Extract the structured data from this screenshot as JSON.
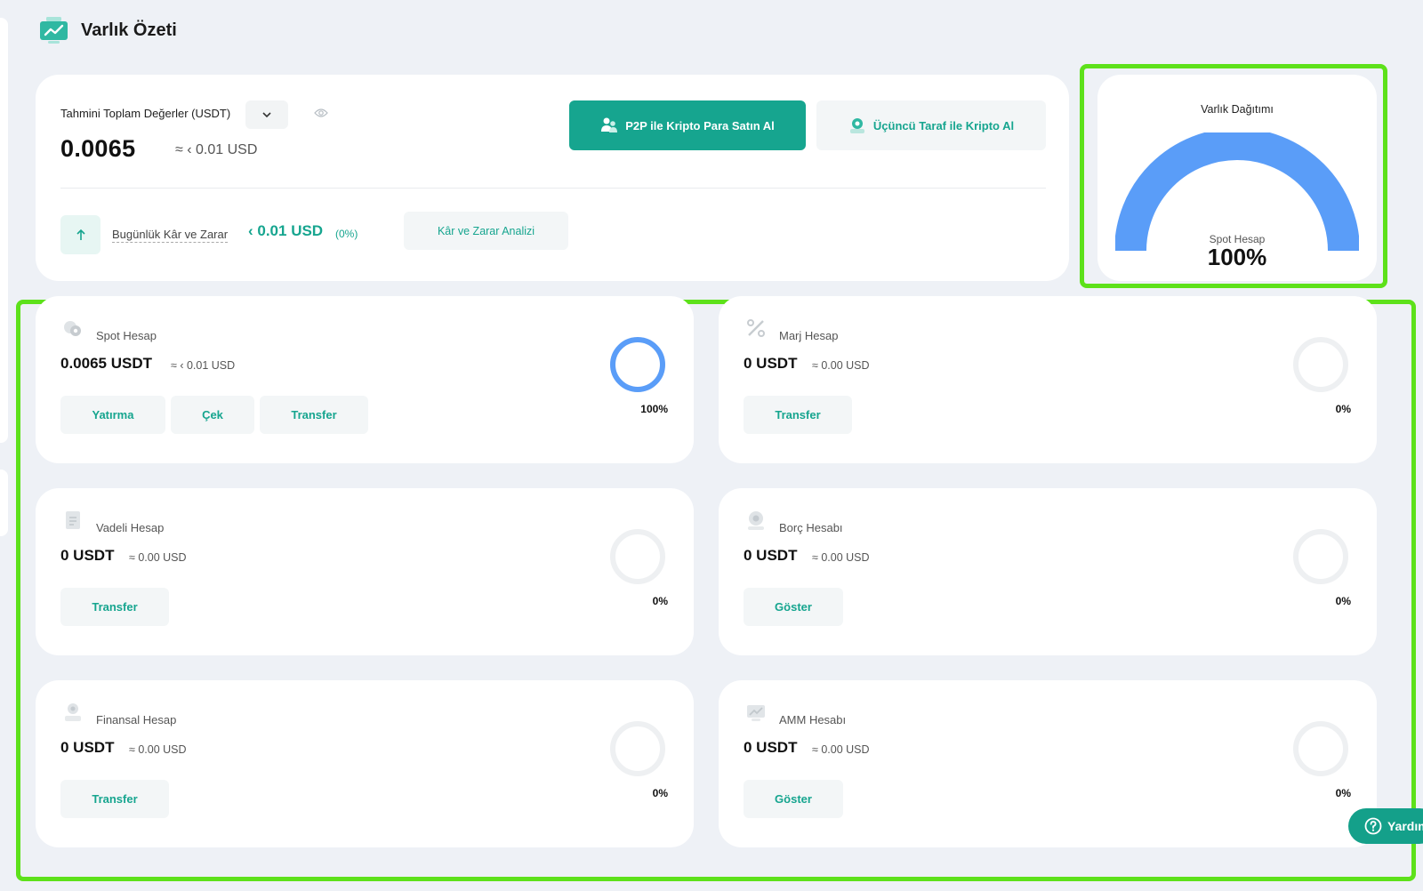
{
  "header": {
    "title": "Varlık Özeti",
    "icon": "chart-monitor-icon"
  },
  "summary": {
    "estimated_label": "Tahmini Toplam Değerler (USDT)",
    "total_value": "0.0065",
    "total_usd": "≈ ‹ 0.01 USD",
    "p2p_button": "P2P ile Kripto Para Satın Al",
    "third_party_button": "Üçüncü Taraf ile Kripto Al",
    "pnl_label": "Bugünlük Kâr ve Zarar",
    "pnl_value": "‹ 0.01 USD",
    "pnl_pct": "(0%)",
    "analysis_button": "Kâr ve Zarar Analizi"
  },
  "distribution": {
    "title": "Varlık Dağıtımı",
    "segment_label": "Spot Hesap",
    "segment_value": "100%",
    "segment_fraction": 1.0,
    "color": "#5a9df8"
  },
  "accounts": [
    {
      "name": "Spot Hesap",
      "icon": "coins-icon",
      "amount": "0.0065 USDT",
      "usd": "≈ ‹ 0.01 USD",
      "pct": "100%",
      "fraction": 1.0,
      "buttons": [
        "Yatırma",
        "Çek",
        "Transfer"
      ]
    },
    {
      "name": "Marj Hesap",
      "icon": "percent-icon",
      "amount": "0 USDT",
      "usd": "≈ 0.00 USD",
      "pct": "0%",
      "fraction": 0,
      "buttons": [
        "Transfer"
      ]
    },
    {
      "name": "Vadeli Hesap",
      "icon": "document-icon",
      "amount": "0 USDT",
      "usd": "≈ 0.00 USD",
      "pct": "0%",
      "fraction": 0,
      "buttons": [
        "Transfer"
      ]
    },
    {
      "name": "Borç Hesabı",
      "icon": "coin-stack-icon",
      "amount": "0 USDT",
      "usd": "≈ 0.00 USD",
      "pct": "0%",
      "fraction": 0,
      "buttons": [
        "Göster"
      ]
    },
    {
      "name": "Finansal Hesap",
      "icon": "finance-icon",
      "amount": "0 USDT",
      "usd": "≈ 0.00 USD",
      "pct": "0%",
      "fraction": 0,
      "buttons": [
        "Transfer"
      ]
    },
    {
      "name": "AMM Hesabı",
      "icon": "chart-icon",
      "amount": "0 USDT",
      "usd": "≈ 0.00 USD",
      "pct": "0%",
      "fraction": 0,
      "buttons": [
        "Göster"
      ]
    }
  ],
  "help": {
    "label": "Yardım"
  },
  "colors": {
    "accent": "#16a58f",
    "highlight": "#5de11a",
    "donut_active": "#5a9df8",
    "donut_empty": "#eef0f2"
  }
}
